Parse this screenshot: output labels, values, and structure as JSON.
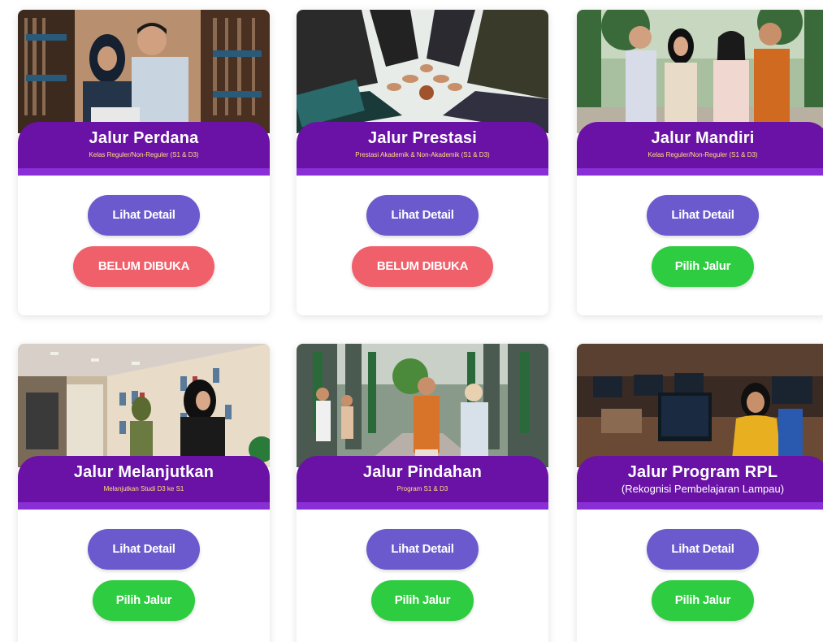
{
  "buttons": {
    "detail_label": "Lihat Detail",
    "closed_label": "BELUM DIBUKA",
    "choose_label": "Pilih Jalur"
  },
  "cards": [
    {
      "title": "Jalur Perdana",
      "subtitle": "Kelas Reguler/Non-Reguler (S1 & D3)",
      "status": "closed"
    },
    {
      "title": "Jalur Prestasi",
      "subtitle": "Prestasi Akademik & Non-Akademik (S1 & D3)",
      "status": "closed"
    },
    {
      "title": "Jalur Mandiri",
      "subtitle": "Kelas Reguler/Non-Reguler (S1 & D3)",
      "status": "open"
    },
    {
      "title": "Jalur Melanjutkan",
      "subtitle": "Melanjutkan Studi D3 ke S1",
      "status": "open"
    },
    {
      "title": "Jalur Pindahan",
      "subtitle": "Program S1 & D3",
      "status": "open"
    },
    {
      "title": "Jalur Program RPL",
      "subtitle": "(Rekognisi Pembelajaran Lampau)",
      "status": "open"
    }
  ],
  "colors": {
    "banner": "#6a12a6",
    "detail_button": "#6a5acd",
    "closed_button": "#f0606b",
    "choose_button": "#2ecc40",
    "subtitle_text": "#ffe07a"
  },
  "icons": {
    "photo_1": "library-students-photo",
    "photo_2": "team-hands-photo",
    "photo_3": "campus-students-photo",
    "photo_4": "library-shelves-photo",
    "photo_5": "campus-walkway-photo",
    "photo_6": "computer-lab-photo"
  }
}
